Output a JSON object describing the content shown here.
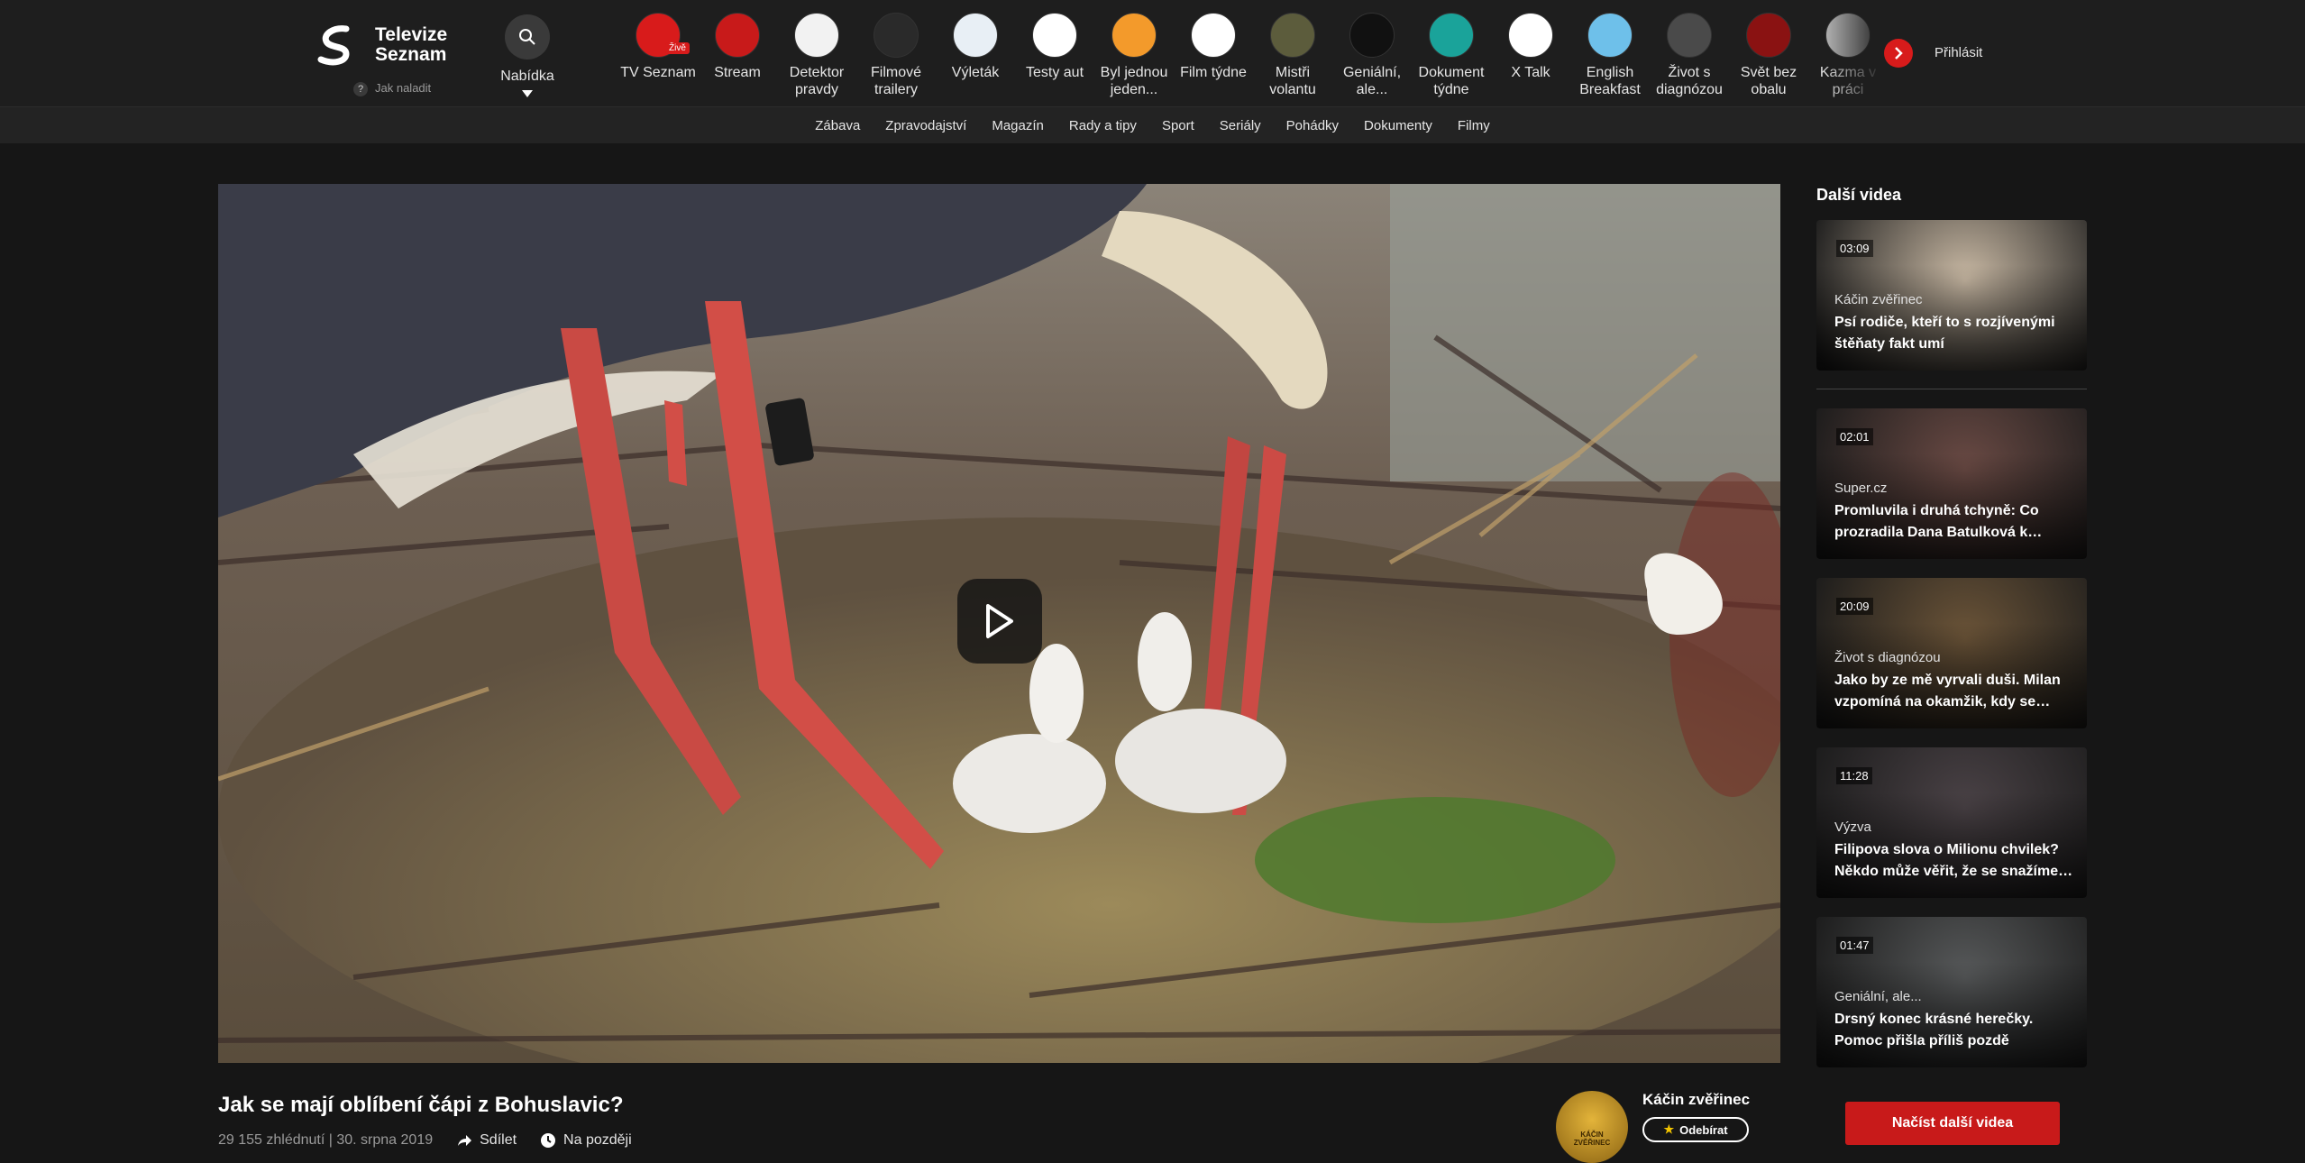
{
  "brand": {
    "name_line1": "Televize",
    "name_line2": "Seznam",
    "tune_label": "Jak naladit"
  },
  "menu": {
    "label": "Nabídka"
  },
  "channels": [
    {
      "label": "TV Seznam",
      "icon": "tv-seznam-icon",
      "badge": "Živě",
      "color": "#d81b1b"
    },
    {
      "label": "Stream",
      "icon": "stream-icon",
      "color": "#c81a1a"
    },
    {
      "label": "Detektor pravdy",
      "icon": "detektor-icon",
      "color": "#f2f2f2"
    },
    {
      "label": "Filmové trailery",
      "icon": "trailers-icon",
      "color": "#2a2a2a"
    },
    {
      "label": "Výleták",
      "icon": "vyletak-icon",
      "color": "#e8eff5"
    },
    {
      "label": "Testy aut",
      "icon": "garaz-icon",
      "color": "#ffffff"
    },
    {
      "label": "Byl jednou jeden...",
      "icon": "byl-jednou-icon",
      "color": "#f39a2b"
    },
    {
      "label": "Film týdne",
      "icon": "film-tydne-icon",
      "color": "#ffffff"
    },
    {
      "label": "Mistři volantu",
      "icon": "mistri-icon",
      "color": "#5c5c3c"
    },
    {
      "label": "Geniální, ale...",
      "icon": "genialni-icon",
      "color": "#111111"
    },
    {
      "label": "Dokument týdne",
      "icon": "dokument-icon",
      "color": "#1aa39a"
    },
    {
      "label": "X Talk",
      "icon": "xtalk-icon",
      "color": "#ffffff"
    },
    {
      "label": "English Breakfast",
      "icon": "english-icon",
      "color": "#6ec0ea"
    },
    {
      "label": "Život s diagnózou",
      "icon": "diagnoza-icon",
      "color": "#4a4a4a"
    },
    {
      "label": "Svět bez obalu",
      "icon": "svet-icon",
      "color": "#8a1212"
    },
    {
      "label": "Kazma v práci",
      "icon": "kazma-icon",
      "color": "#bdbdbd"
    }
  ],
  "login": "Přihlásit",
  "categories": [
    "Zábava",
    "Zpravodajství",
    "Magazín",
    "Rady a tipy",
    "Sport",
    "Seriály",
    "Pohádky",
    "Dokumenty",
    "Filmy"
  ],
  "video": {
    "title": "Jak se mají oblíbení čápi z Bohuslavic?",
    "stats": "29 155 zhlédnutí | 30. srpna 2019",
    "share": "Sdílet",
    "later": "Na později"
  },
  "channel": {
    "name": "Káčin zvěřinec",
    "thumb_text": "KÁČIN ZVĚŘINEC",
    "subscribe": "Odebírat"
  },
  "sidebar": {
    "title": "Další videa",
    "items": [
      {
        "duration": "03:09",
        "source": "Káčin zvěřinec",
        "title": "Psí rodiče, kteří to s rozjívenými štěňaty fakt umí",
        "color": "#c9b9a4"
      },
      {
        "duration": "02:01",
        "source": "Super.cz",
        "title": "Promluvila i druhá tchyně: Co prozradila Dana Batulková k…",
        "color": "#6a4a44"
      },
      {
        "duration": "20:09",
        "source": "Život s diagnózou",
        "title": "Jako by ze mě vyrvali duši. Milan vzpomíná na okamžik, kdy se…",
        "color": "#6b5438"
      },
      {
        "duration": "11:28",
        "source": "Výzva",
        "title": "Filipova slova o Milionu chvilek? Někdo může věřit, že se snažíme…",
        "color": "#4a4246"
      },
      {
        "duration": "01:47",
        "source": "Geniální, ale...",
        "title": "Drsný konec krásné herečky. Pomoc přišla příliš pozdě",
        "color": "#57595a"
      }
    ],
    "load_more": "Načíst další videa"
  },
  "colors": {
    "accent": "#d81b1b",
    "background": "#161616",
    "topbar": "#1e1e1e"
  }
}
